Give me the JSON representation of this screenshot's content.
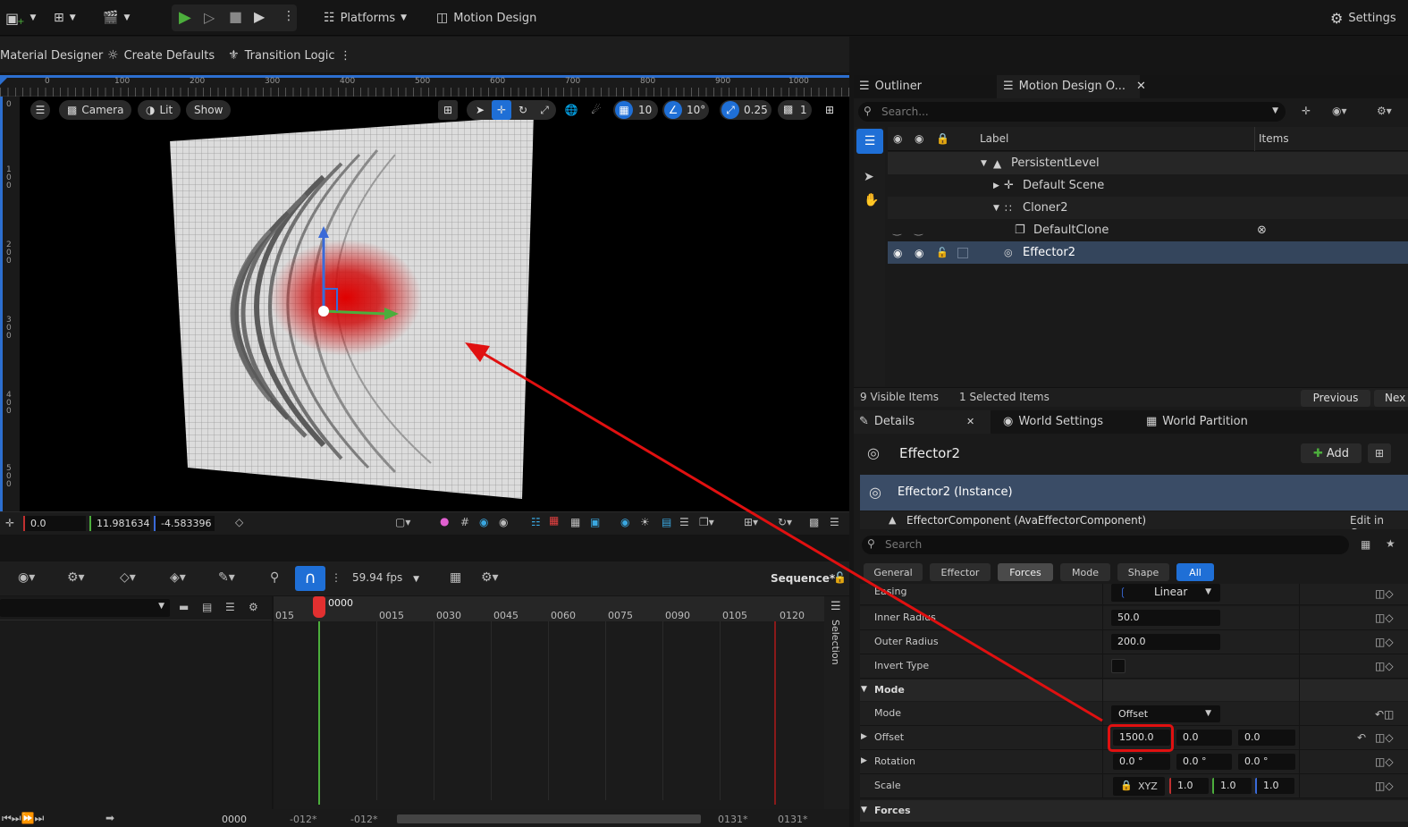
{
  "toolbar": {
    "platforms_label": "Platforms",
    "motion_design_label": "Motion Design",
    "settings_label": "Settings"
  },
  "toolbar2": {
    "material_designer_label": "Material Designer",
    "create_defaults_label": "Create Defaults",
    "transition_logic_label": "Transition Logic"
  },
  "viewport": {
    "ruler_ticks": [
      "0",
      "100",
      "200",
      "300",
      "400",
      "500",
      "600",
      "700",
      "800",
      "900",
      "1000"
    ],
    "left_ruler_ticks": [
      "0",
      "100",
      "200",
      "300",
      "400",
      "500"
    ],
    "camera_label": "Camera",
    "lit_label": "Lit",
    "show_label": "Show",
    "grid_snap": "10",
    "angle_snap": "10°",
    "scale_snap": "0.25",
    "camera_speed": "1"
  },
  "coords": {
    "x": "0.0",
    "y": "11.981634",
    "z": "-4.583396"
  },
  "sequencer": {
    "fps_label": "59.94 fps",
    "sequence_label": "Sequence*",
    "current_frame": "0000",
    "ruler_labels": [
      "015",
      "0015",
      "0030",
      "0045",
      "0060",
      "0075",
      "0090",
      "0105",
      "0120"
    ],
    "selection_label": "Selection",
    "bottom_frame": "0000",
    "bottom_left_a": "-012*",
    "bottom_left_b": "-012*",
    "bottom_right_a": "0131*",
    "bottom_right_b": "0131*"
  },
  "outliner": {
    "tab_outliner": "Outliner",
    "tab_motion_design": "Motion Design O...",
    "search_placeholder": "Search...",
    "col_label": "Label",
    "col_items": "Items",
    "rows": [
      {
        "label": "PersistentLevel"
      },
      {
        "label": "Default Scene"
      },
      {
        "label": "Cloner2"
      },
      {
        "label": "DefaultClone"
      },
      {
        "label": "Effector2"
      }
    ],
    "visible_items": "9 Visible Items",
    "selected_items": "1 Selected Items",
    "previous_label": "Previous",
    "next_label": "Nex"
  },
  "details": {
    "tab_details": "Details",
    "tab_world_settings": "World Settings",
    "tab_world_partition": "World Partition",
    "actor_name": "Effector2",
    "add_label": "Add",
    "instance_label": "Effector2 (Instance)",
    "component_label": "EffectorComponent (AvaEffectorComponent)",
    "edit_cpp_label": "Edit in C++",
    "search_placeholder": "Search",
    "categories": [
      "General",
      "Effector",
      "Forces",
      "Mode",
      "Shape",
      "All"
    ],
    "easing_label": "Easing",
    "easing_value": "Linear",
    "inner_radius_label": "Inner Radius",
    "inner_radius_value": "50.0",
    "outer_radius_label": "Outer Radius",
    "outer_radius_value": "200.0",
    "invert_type_label": "Invert Type",
    "mode_section": "Mode",
    "mode_label": "Mode",
    "mode_value": "Offset",
    "offset_label": "Offset",
    "offset_x": "1500.0",
    "offset_y": "0.0",
    "offset_z": "0.0",
    "rotation_label": "Rotation",
    "rotation_x": "0.0 °",
    "rotation_y": "0.0 °",
    "rotation_z": "0.0 °",
    "scale_label": "Scale",
    "scale_lock": "XYZ",
    "scale_x": "1.0",
    "scale_y": "1.0",
    "scale_z": "1.0",
    "forces_section": "Forces"
  },
  "colors": {
    "accent_blue": "#1f6fd6",
    "highlight_red": "#e01010",
    "play_green": "#4cae3c",
    "selected_row": "#34455c"
  }
}
